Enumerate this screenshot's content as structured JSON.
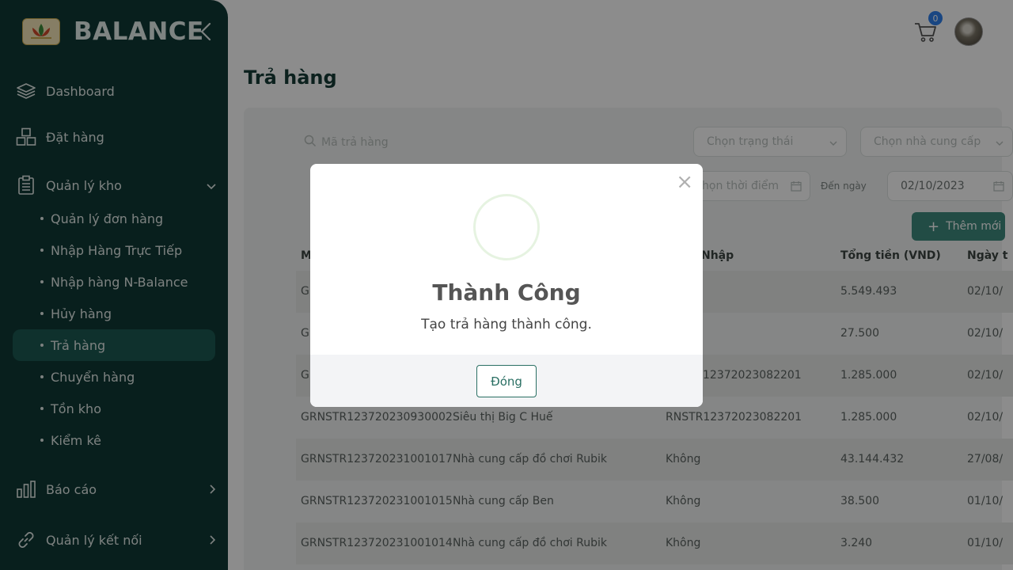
{
  "sidebar": {
    "brand": "BALANCE",
    "items": [
      {
        "label": "Dashboard",
        "icon": "layers-icon"
      },
      {
        "label": "Đặt hàng",
        "icon": "boxes-icon"
      },
      {
        "label": "Quản lý kho",
        "icon": "clipboard-icon"
      }
    ],
    "sub_items": [
      {
        "label": "Quản lý đơn hàng"
      },
      {
        "label": "Nhập Hàng Trực Tiếp"
      },
      {
        "label": "Nhập hàng N-Balance"
      },
      {
        "label": "Hủy hàng"
      },
      {
        "label": "Trả hàng"
      },
      {
        "label": "Chuyển hàng"
      },
      {
        "label": "Tồn kho"
      },
      {
        "label": "Kiểm kê"
      }
    ],
    "bottom_items": [
      {
        "label": "Báo cáo",
        "icon": "bar-chart-icon"
      },
      {
        "label": "Quản lý kết nối",
        "icon": "link-icon"
      }
    ],
    "active_sub": "Trả hàng"
  },
  "header": {
    "cart_count": "0"
  },
  "page": {
    "title": "Trả hàng"
  },
  "filters": {
    "search_placeholder": "Mã trả hàng",
    "status_placeholder": "Chọn trạng thái",
    "supplier_placeholder": "Chọn nhà cung cấp",
    "from_date_placeholder": "họn thời điểm",
    "to_label": "Đến ngày",
    "to_date": "02/10/2023",
    "add_label": "Thêm mới"
  },
  "table": {
    "headers": [
      "M",
      "Nhập",
      "Tổng tiền (VND)",
      "Ngày t"
    ],
    "rows": [
      {
        "c1": "G",
        "c2": "",
        "c3": "",
        "c4": "5.549.493",
        "c5": "02/10/"
      },
      {
        "c1": "G",
        "c2": "",
        "c3": "",
        "c4": "27.500",
        "c5": "02/10/"
      },
      {
        "c1": "G",
        "c2": "",
        "c3": "12372023082201",
        "c4": "1.285.000",
        "c5": "02/10/"
      },
      {
        "c1": "GRNSTR123720230930002",
        "c2": "Siêu thị Big C Huế",
        "c3": "RNSTR12372023082201",
        "c4": "1.285.000",
        "c5": "02/10/"
      },
      {
        "c1": "GRNSTR123720231001017",
        "c2": "Nhà cung cấp đồ chơi Rubik",
        "c3": "Không",
        "c4": "43.144.432",
        "c5": "27/08/"
      },
      {
        "c1": "GRNSTR123720231001015",
        "c2": "Nhà cung cấp Ben",
        "c3": "Không",
        "c4": "38.500",
        "c5": "01/10/"
      },
      {
        "c1": "GRNSTR123720231001014",
        "c2": "Nhà cung cấp đồ chơi Rubik",
        "c3": "Không",
        "c4": "3.240",
        "c5": "01/10/"
      }
    ]
  },
  "modal": {
    "title": "Thành Công",
    "message": "Tạo trả hàng thành công.",
    "button": "Đóng",
    "close_icon": "×"
  }
}
